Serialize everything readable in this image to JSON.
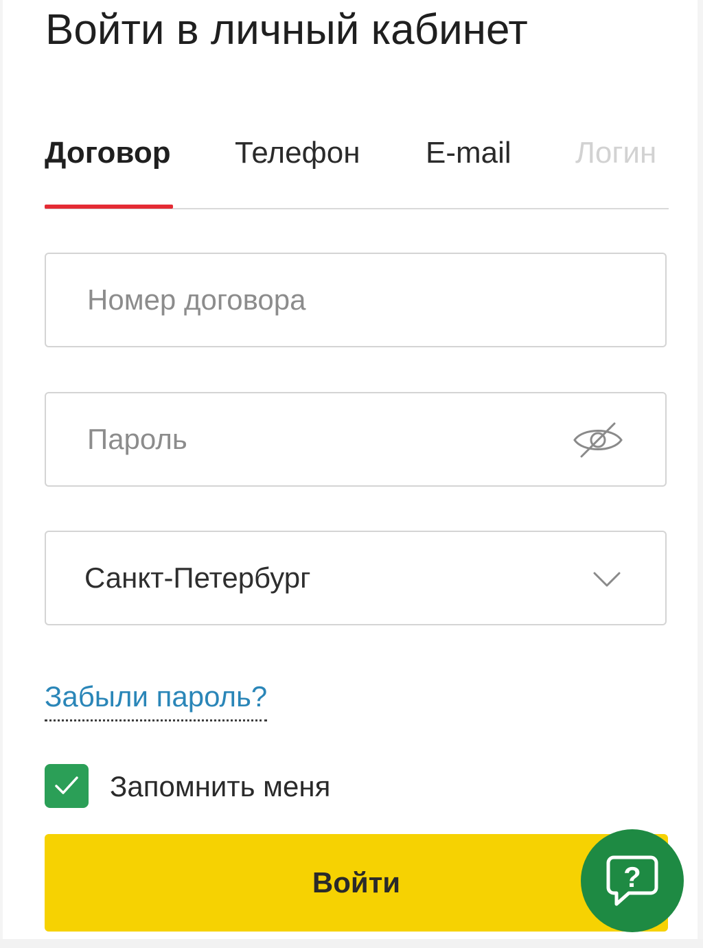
{
  "page": {
    "title": "Войти в личный кабинет"
  },
  "tabs": {
    "active_index": 0,
    "items": [
      {
        "label": "Договор",
        "state": "active"
      },
      {
        "label": "Телефон",
        "state": "default"
      },
      {
        "label": "E-mail",
        "state": "default"
      },
      {
        "label": "Логин",
        "state": "faded"
      }
    ]
  },
  "form": {
    "contract_field": {
      "value": "",
      "placeholder": "Номер договора"
    },
    "password_field": {
      "value": "",
      "placeholder": "Пароль",
      "icon": "eye-off-icon"
    },
    "city_select": {
      "selected": "Санкт-Петербург",
      "icon": "chevron-down-icon"
    },
    "forgot_password_link": "Забыли пароль?",
    "remember_me": {
      "label": "Запомнить меня",
      "checked": true
    },
    "submit_label": "Войти"
  },
  "help_button": {
    "icon": "help-chat-icon",
    "symbol": "?"
  },
  "colors": {
    "accent_red": "#e42b34",
    "link_blue": "#2a86b8",
    "checkbox_green": "#2b9f57",
    "button_yellow": "#f6d202",
    "help_green": "#1e8a43"
  }
}
